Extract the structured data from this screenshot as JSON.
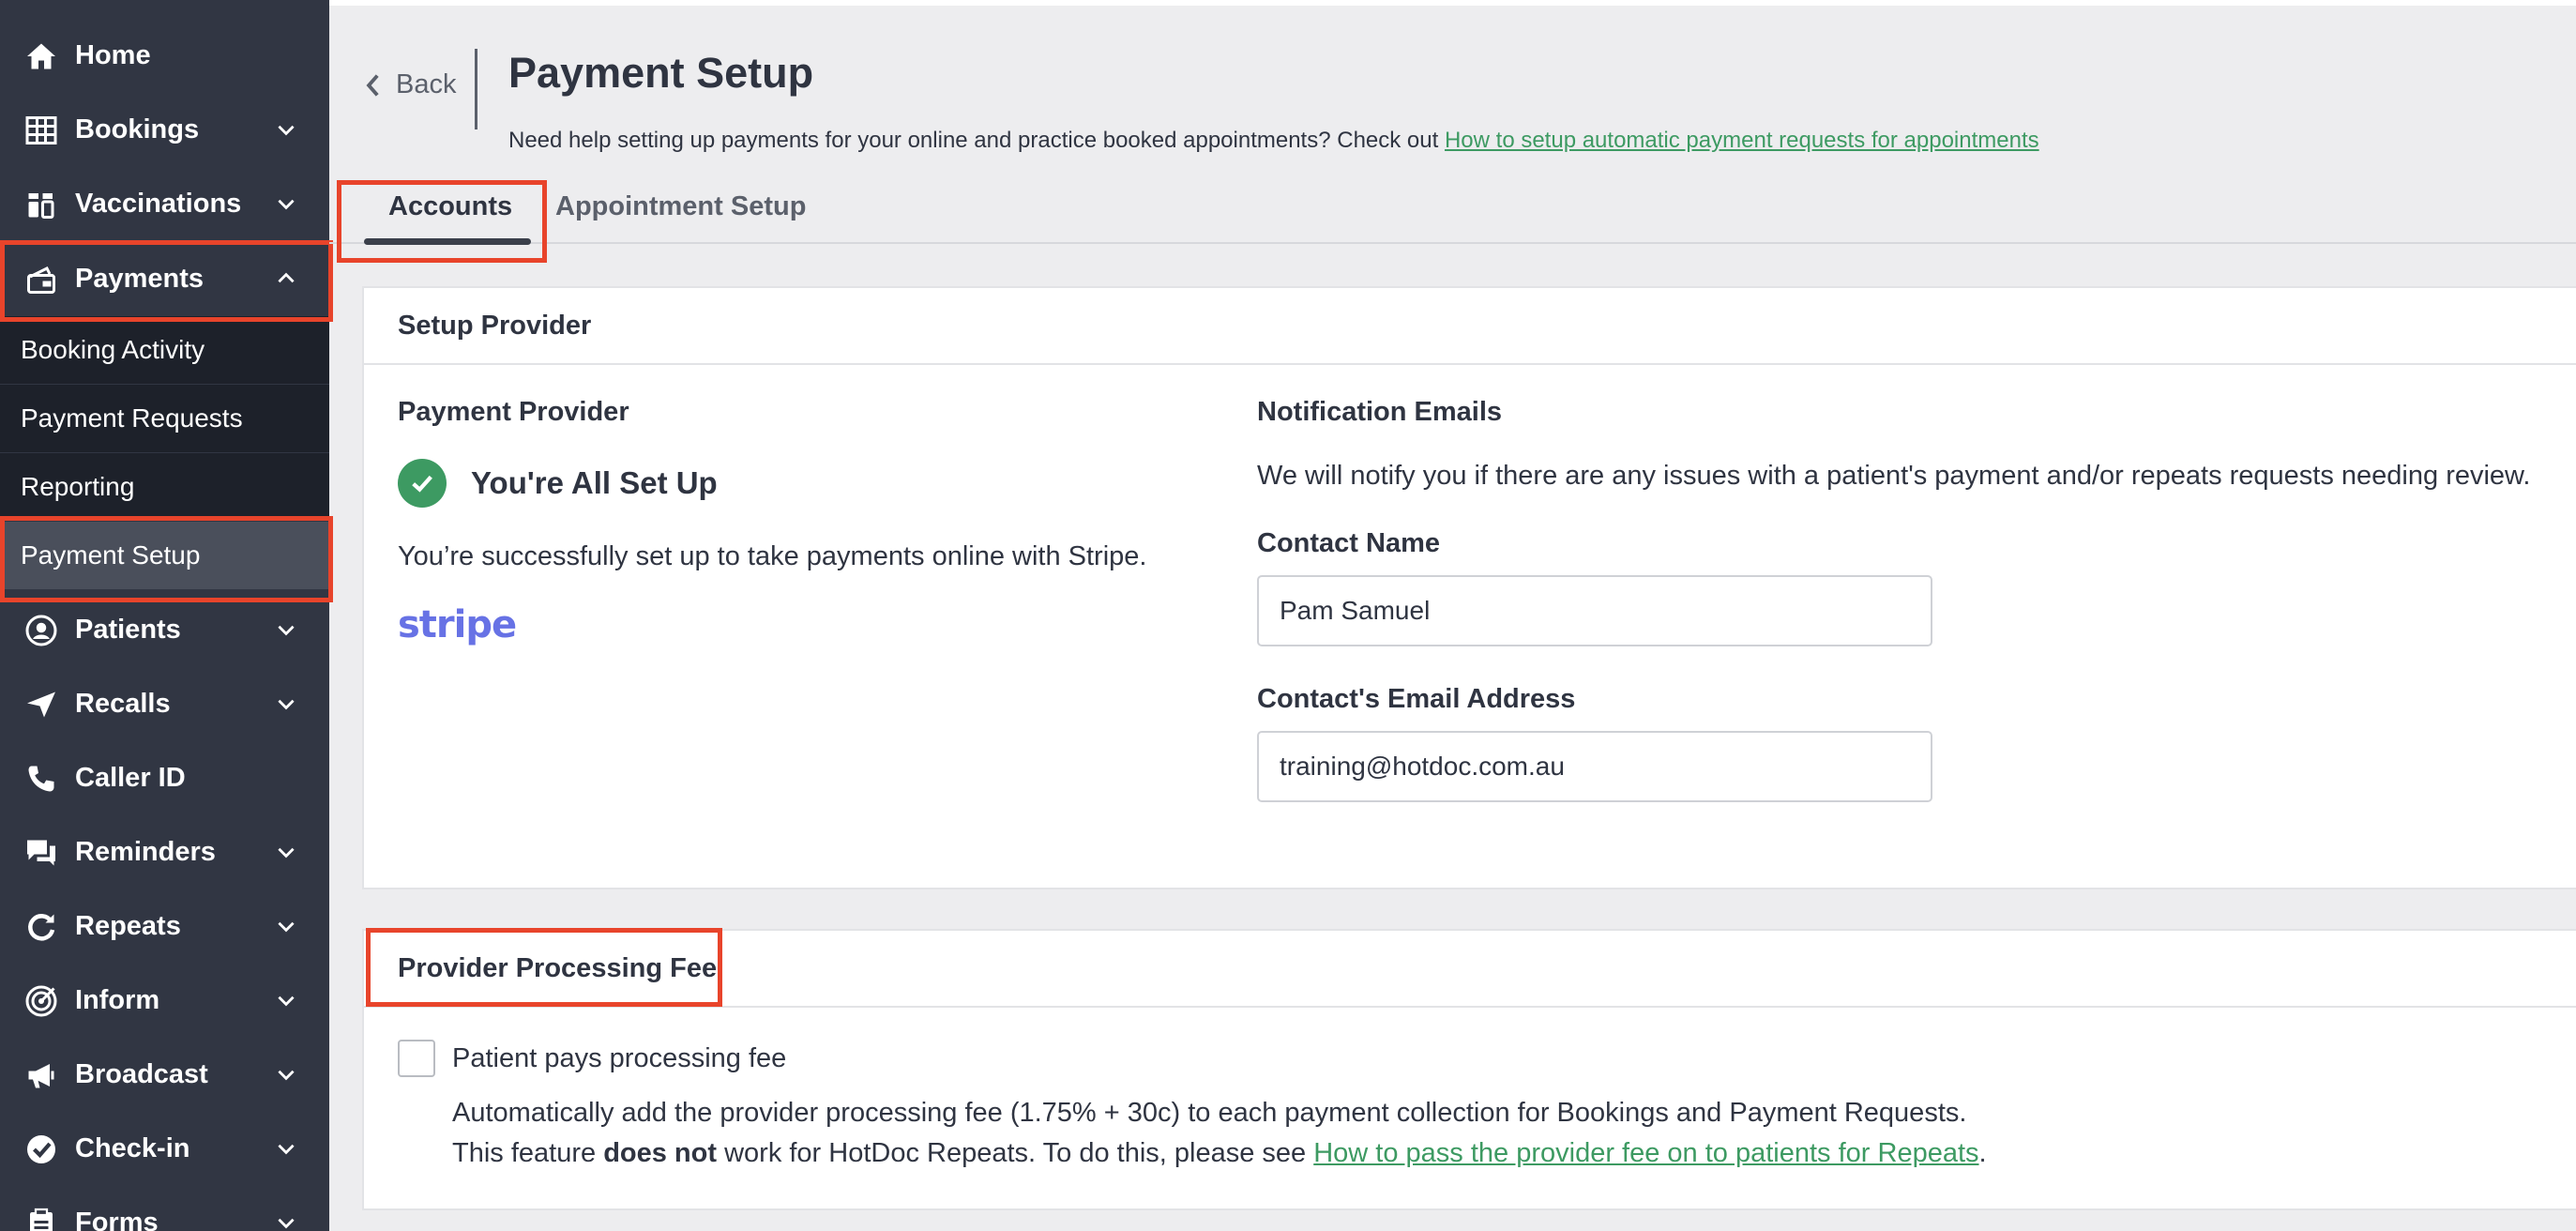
{
  "sidebar": {
    "items": [
      {
        "label": "Home",
        "icon": "home-icon"
      },
      {
        "label": "Bookings",
        "icon": "calendar-grid-icon"
      },
      {
        "label": "Vaccinations",
        "icon": "vials-icon"
      },
      {
        "label": "Payments",
        "icon": "payment-card-icon"
      },
      {
        "label": "Patients",
        "icon": "user-circle-icon"
      },
      {
        "label": "Recalls",
        "icon": "paper-plane-icon"
      },
      {
        "label": "Caller ID",
        "icon": "phone-icon"
      },
      {
        "label": "Reminders",
        "icon": "chat-bubbles-icon"
      },
      {
        "label": "Repeats",
        "icon": "refresh-icon"
      },
      {
        "label": "Inform",
        "icon": "target-icon"
      },
      {
        "label": "Broadcast",
        "icon": "megaphone-icon"
      },
      {
        "label": "Check-in",
        "icon": "check-badge-icon"
      },
      {
        "label": "Forms",
        "icon": "clipboard-icon"
      }
    ],
    "payments_sub": [
      "Booking Activity",
      "Payment Requests",
      "Reporting",
      "Payment Setup"
    ]
  },
  "header": {
    "back_label": "Back",
    "title": "Payment Setup",
    "help_prefix": "Need help setting up payments for your online and practice booked appointments? Check out ",
    "help_link": "How to setup automatic payment requests for appointments"
  },
  "tabs": [
    "Accounts",
    "Appointment Setup"
  ],
  "setup_provider": {
    "title": "Setup Provider",
    "payment_provider_label": "Payment Provider",
    "status": "You're All Set Up",
    "description": "You’re successfully set up to take payments online with Stripe.",
    "logo_text": "stripe",
    "notification_label": "Notification Emails",
    "notification_desc": "We will notify you if there are any issues with a patient's payment and/or repeats requests needing review.",
    "contact_name_label": "Contact Name",
    "contact_name_value": "Pam Samuel",
    "contact_email_label": "Contact's Email Address",
    "contact_email_value": "training@hotdoc.com.au"
  },
  "processing_fee": {
    "title": "Provider Processing Fee",
    "checkbox_label": "Patient pays processing fee",
    "desc1": "Automatically add the provider processing fee (1.75% + 30c) to each payment collection for Bookings and Payment Requests.",
    "desc2_prefix": "This feature ",
    "desc2_bold": "does not",
    "desc2_middle": " work for HotDoc Repeats. To do this, please see ",
    "desc2_link": "How to pass the provider fee on to patients for Repeats",
    "desc2_suffix": "."
  },
  "colors": {
    "sidebar_bg": "#313643",
    "submenu_bg": "#1d212a",
    "accent_green": "#3d9a62",
    "highlight_red": "#e8442b",
    "stripe_purple": "#6772e5"
  }
}
